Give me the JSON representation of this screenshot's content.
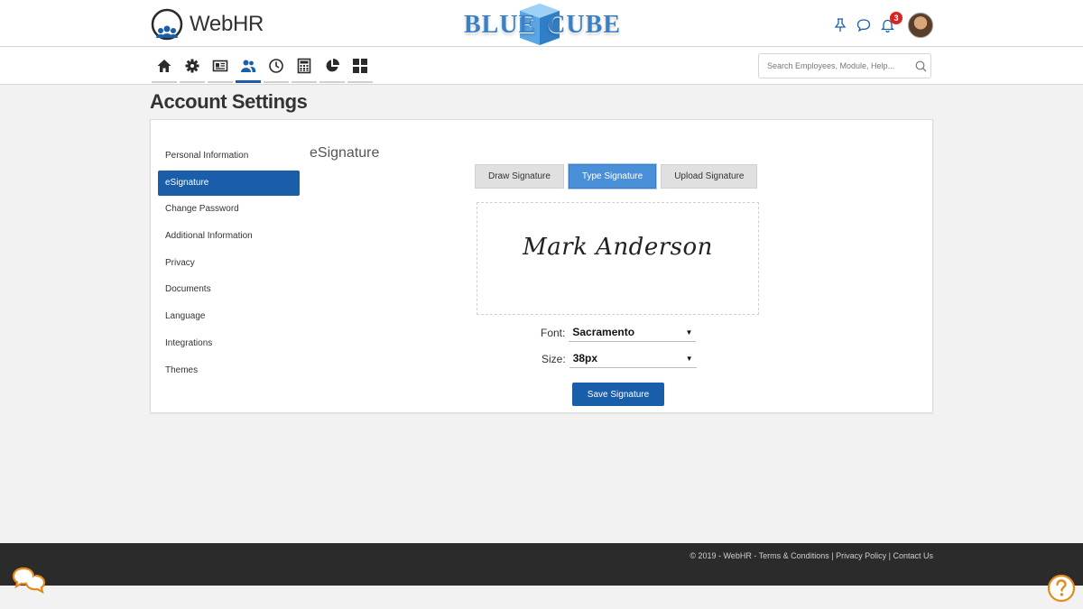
{
  "app": {
    "name": "WebHR"
  },
  "brand": {
    "left": "BLUE",
    "right": "CUBE"
  },
  "notifications": {
    "count": "3"
  },
  "search": {
    "placeholder": "Search Employees, Module, Help..."
  },
  "nav": {
    "active_index": 3,
    "icons": [
      "home-icon",
      "gear-icon",
      "id-card-icon",
      "people-icon",
      "clock-icon",
      "calculator-icon",
      "pie-chart-icon",
      "grid-icon"
    ]
  },
  "page": {
    "title": "Account Settings"
  },
  "sidebar": {
    "items": [
      {
        "label": "Personal Information",
        "active": false
      },
      {
        "label": "eSignature",
        "active": true
      },
      {
        "label": "Change Password",
        "active": false
      },
      {
        "label": "Additional Information",
        "active": false
      },
      {
        "label": "Privacy",
        "active": false
      },
      {
        "label": "Documents",
        "active": false
      },
      {
        "label": "Language",
        "active": false
      },
      {
        "label": "Integrations",
        "active": false
      },
      {
        "label": "Themes",
        "active": false
      }
    ]
  },
  "esignature": {
    "title": "eSignature",
    "tabs": [
      {
        "label": "Draw Signature",
        "active": false
      },
      {
        "label": "Type Signature",
        "active": true
      },
      {
        "label": "Upload Signature",
        "active": false
      }
    ],
    "signature_text": "Mark Anderson",
    "font_label": "Font:",
    "font_value": "Sacramento",
    "size_label": "Size:",
    "size_value": "38px",
    "save_label": "Save Signature"
  },
  "footer": {
    "copyright": "© 2019 - WebHR -",
    "links": [
      "Terms & Conditions",
      "Privacy Policy",
      "Contact Us"
    ]
  },
  "colors": {
    "primary": "#1a5da8",
    "tab_active": "#4a90d9",
    "footer_bg": "#2b2b2b",
    "badge": "#e02020",
    "fab": "#e88a1a"
  }
}
